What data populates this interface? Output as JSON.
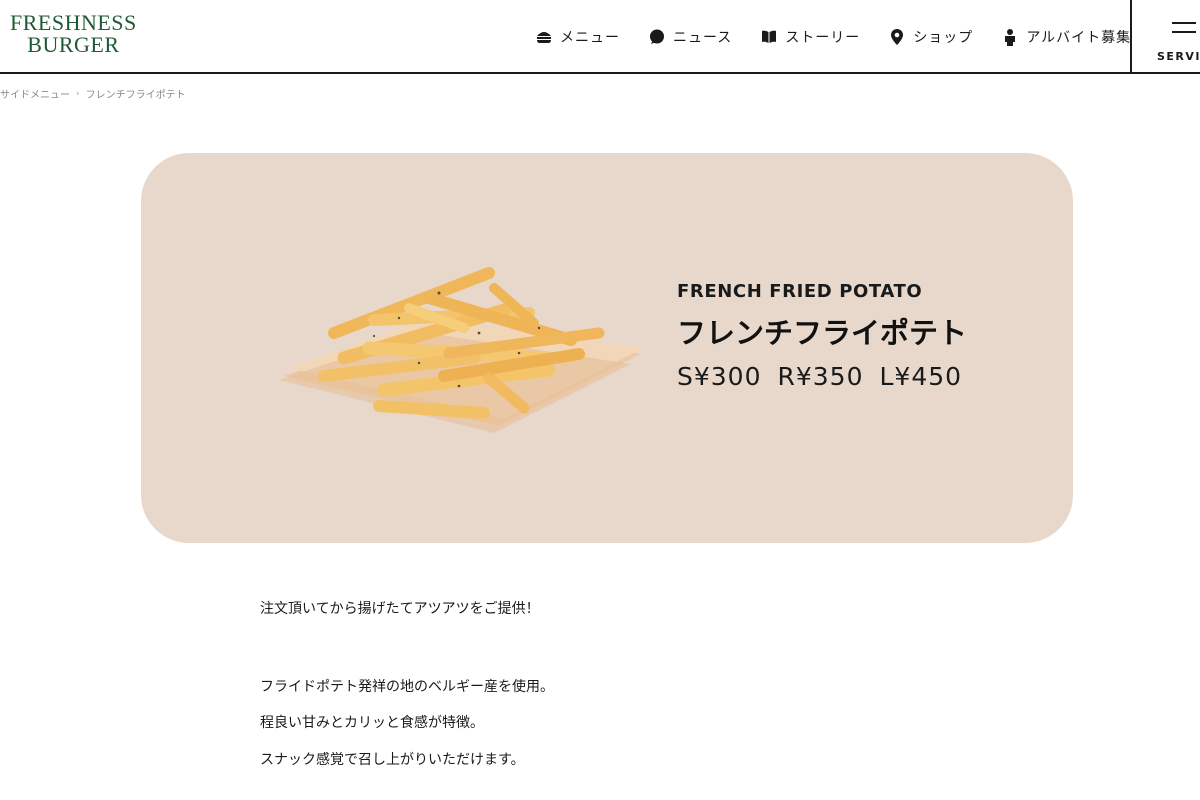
{
  "brand": {
    "line1": "FRESHNESS",
    "line2": "BURGER",
    "color": "#1f5a34"
  },
  "nav": [
    {
      "label": "メニュー",
      "icon": "burger-icon"
    },
    {
      "label": "ニュース",
      "icon": "speech-bubble-icon"
    },
    {
      "label": "ストーリー",
      "icon": "book-icon"
    },
    {
      "label": "ショップ",
      "icon": "map-pin-icon"
    },
    {
      "label": "アルバイト募集",
      "icon": "person-icon"
    }
  ],
  "service": {
    "label": "SERVICE"
  },
  "breadcrumb": {
    "parent": "サイドメニュー",
    "current": "フレンチフライポテト"
  },
  "product": {
    "name_en": "FRENCH FRIED POTATO",
    "name_jp": "フレンチフライポテト",
    "prices": [
      "S¥300",
      "R¥350",
      "L¥450"
    ],
    "card_color": "#e8d8cc"
  },
  "description": {
    "line1": "注文頂いてから揚げたてアツアツをご提供！",
    "line2": "フライドポテト発祥の地のベルギー産を使用。",
    "line3": "程良い甘みとカリッと食感が特徴。",
    "line4": "スナック感覚で召し上がりいただけます。"
  }
}
